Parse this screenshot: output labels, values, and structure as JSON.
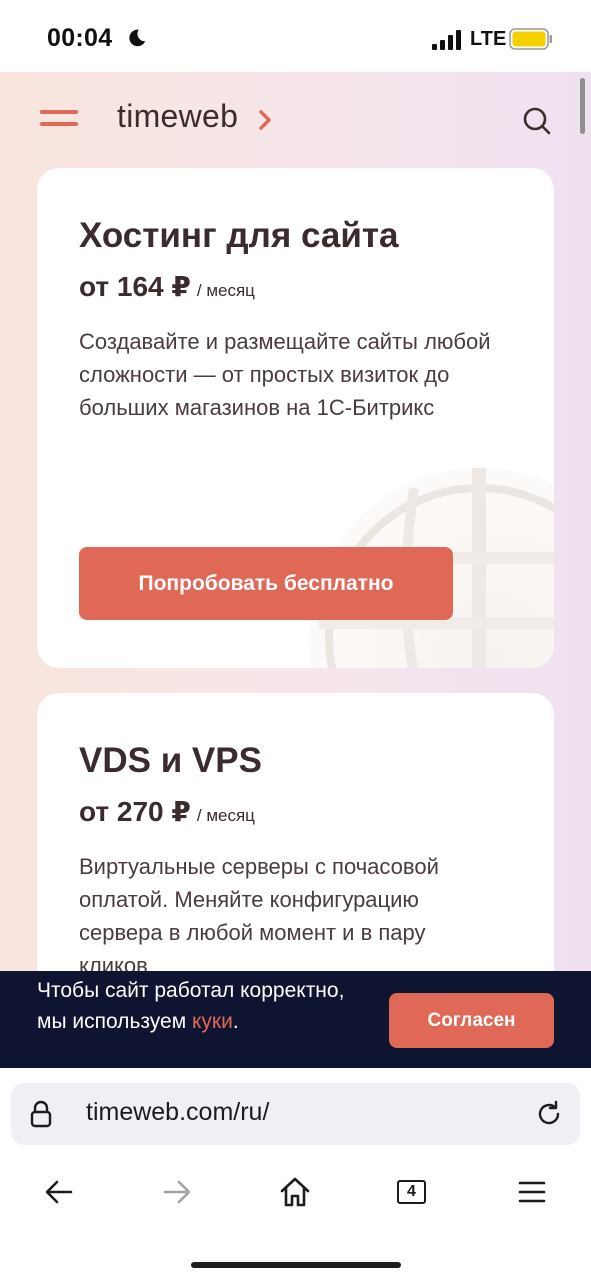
{
  "status_bar": {
    "time": "00:04",
    "network": "LTE",
    "battery_color": "#f5d000"
  },
  "header": {
    "logo": "timeweb",
    "accent_color": "#e06856",
    "menu_icon": "hamburger-icon",
    "search_icon": "search-icon"
  },
  "cards": [
    {
      "title": "Хостинг для сайта",
      "price": "от 164 ₽",
      "period": "/ месяц",
      "description": "Создавайте и размещайте сайты любой сложности — от простых визиток до больших магазинов на 1С-Битрикс",
      "button_label": "Попробовать бесплатно"
    },
    {
      "title": "VDS и VPS",
      "price": "от 270 ₽",
      "period": "/ месяц",
      "description": "Виртуальные серверы с почасовой оплатой. Меняйте конфигурацию сервера в любой момент и в пару кликов"
    }
  ],
  "cookie_banner": {
    "text": "Чтобы сайт работал корректно, мы используем ",
    "link": "куки",
    "suffix": ".",
    "button_label": "Согласен",
    "background": "#0f1430"
  },
  "browser": {
    "url": "timeweb.com/ru/",
    "tabs_count": "4",
    "nav_icons": [
      "back-arrow-icon",
      "forward-arrow-icon",
      "home-icon",
      "tabs-icon",
      "menu-icon"
    ]
  }
}
